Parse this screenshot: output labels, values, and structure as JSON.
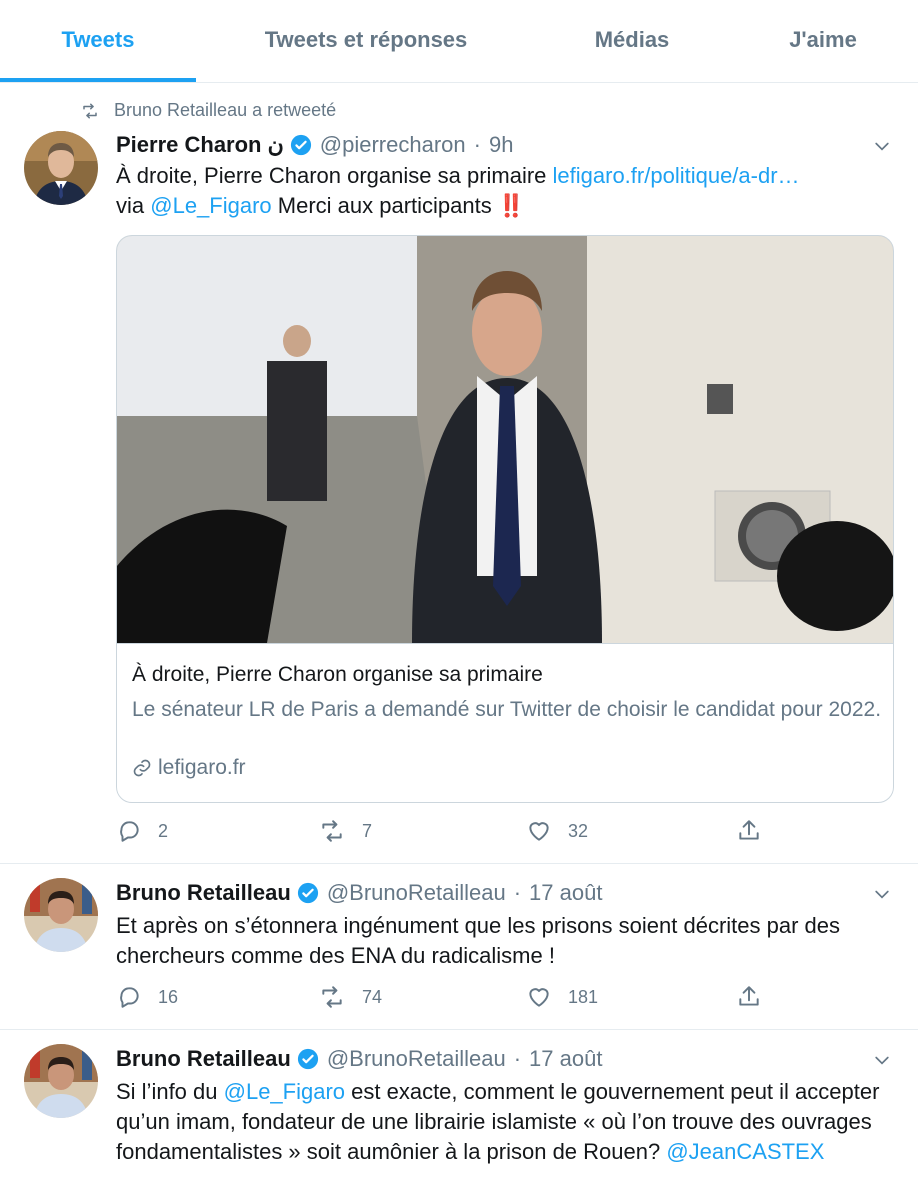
{
  "tabs": [
    {
      "label": "Tweets",
      "active": true
    },
    {
      "label": "Tweets et réponses",
      "active": false
    },
    {
      "label": "Médias",
      "active": false
    },
    {
      "label": "J'aime",
      "active": false
    }
  ],
  "colors": {
    "accent": "#1da1f2",
    "muted": "#657786",
    "text": "#14171a",
    "border": "#e6ecf0",
    "alert": "#e0245e"
  },
  "tweets": [
    {
      "retweeted_by": "Bruno Retailleau a retweeté",
      "author_name": "Pierre Charon ن",
      "handle": "@pierrecharon",
      "separator": "·",
      "time": "9h",
      "text_part1": "À droite, Pierre Charon organise sa primaire ",
      "link_url": "lefigaro.fr/politique/a-dr…",
      "text_via": "via ",
      "mention": "@Le_Figaro",
      "text_part2": "  Merci aux participants ",
      "emoji": "‼️",
      "card": {
        "title": "À droite, Pierre Charon organise sa primaire",
        "description": "Le sénateur LR de Paris a demandé sur Twitter de choisir le candidat pour 2022.",
        "domain": "lefigaro.fr"
      },
      "replies": "2",
      "retweets": "7",
      "likes": "32"
    },
    {
      "author_name": "Bruno Retailleau",
      "handle": "@BrunoRetailleau",
      "separator": "·",
      "time": "17 août",
      "text": "Et après on s’étonnera ingénument que les prisons soient décrites par des chercheurs comme des ENA du radicalisme !",
      "replies": "16",
      "retweets": "74",
      "likes": "181"
    },
    {
      "author_name": "Bruno Retailleau",
      "handle": "@BrunoRetailleau",
      "separator": "·",
      "time": "17 août",
      "text_part1": "Si l’info du ",
      "mention1": "@Le_Figaro",
      "text_part2": " est exacte, comment le gouvernement peut il accepter qu’un imam, fondateur de une librairie islamiste « où l’on trouve des ouvrages fondamentalistes » soit aumônier à la prison de Rouen? ",
      "mention2": "@JeanCASTEX"
    }
  ]
}
